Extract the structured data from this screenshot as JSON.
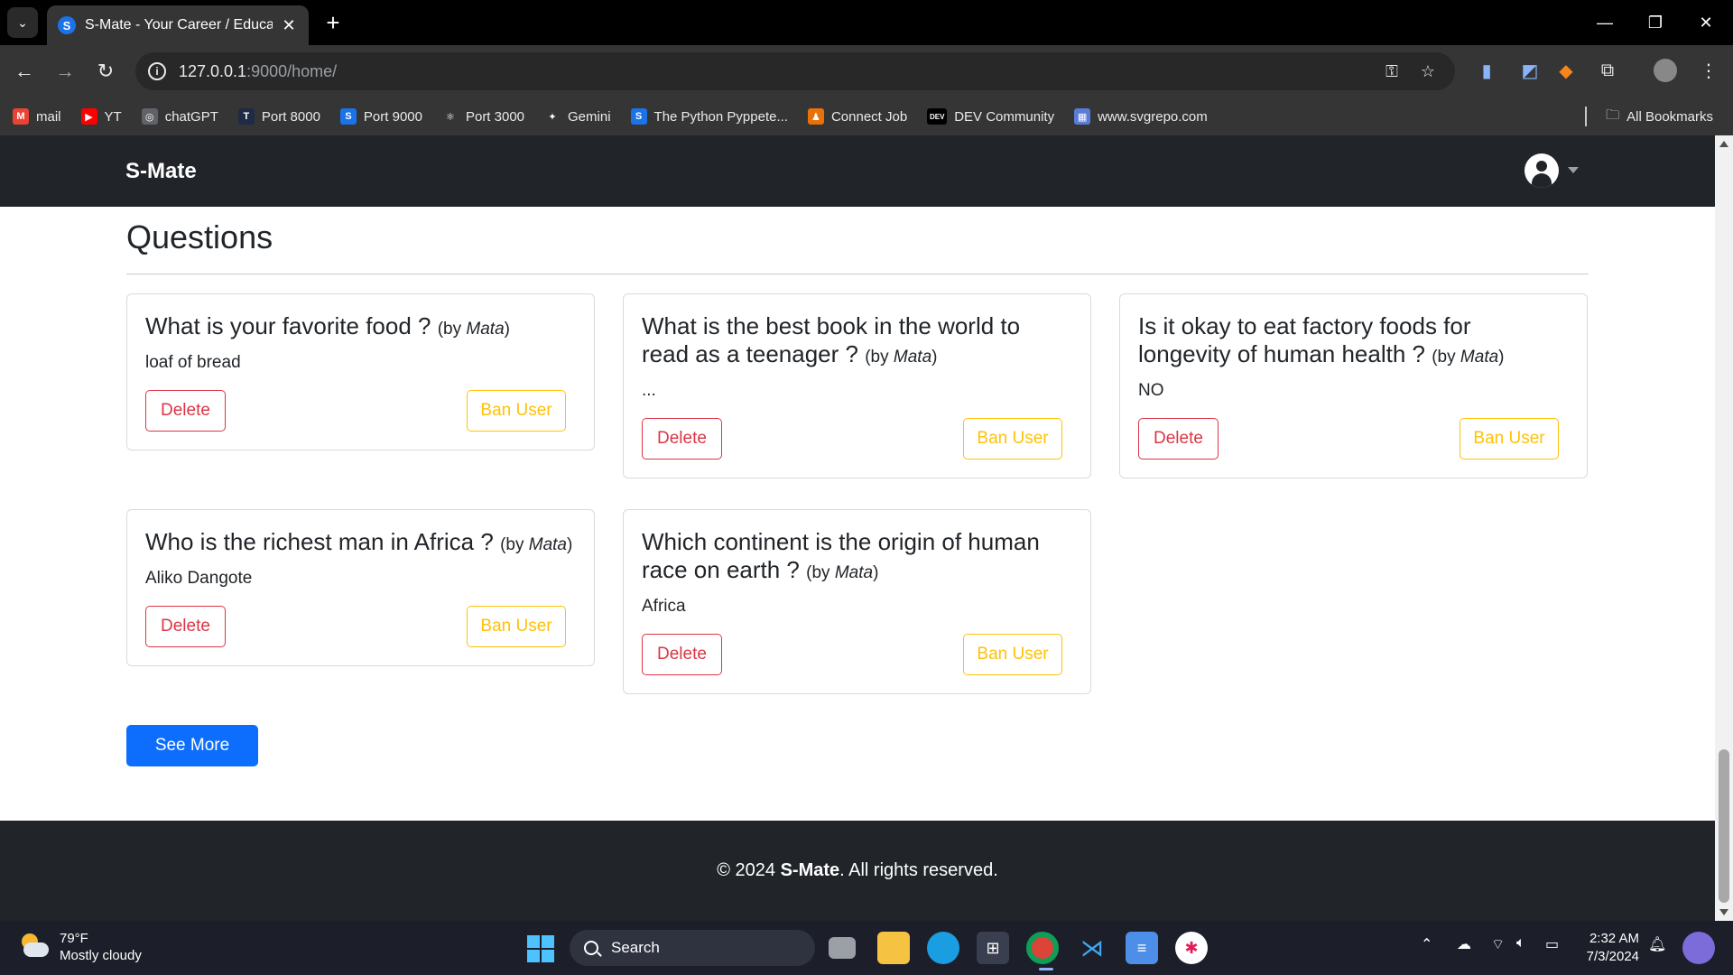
{
  "browser": {
    "tab_title": "S-Mate - Your Career / Educatio",
    "tab_favicon_letter": "S",
    "url_host": "127.0.0.1",
    "url_rest": ":9000/home/",
    "bookmarks": [
      {
        "label": "mail",
        "icon": "gmail-icon",
        "color": "#ea4335",
        "glyph": "M"
      },
      {
        "label": "YT",
        "icon": "youtube-icon",
        "color": "#ff0000",
        "glyph": "▶"
      },
      {
        "label": "chatGPT",
        "icon": "chatgpt-icon",
        "color": "#5f6368",
        "glyph": "◎"
      },
      {
        "label": "Port 8000",
        "icon": "port-8000-icon",
        "color": "#1f2a44",
        "glyph": "T"
      },
      {
        "label": "Port 9000",
        "icon": "port-9000-icon",
        "color": "#1a73e8",
        "glyph": "S"
      },
      {
        "label": "Port 3000",
        "icon": "react-icon",
        "color": "#353535",
        "glyph": "⚛"
      },
      {
        "label": "Gemini",
        "icon": "gemini-icon",
        "color": "#353535",
        "glyph": "✦"
      },
      {
        "label": "The Python Pyppete...",
        "icon": "python-pyppeteer-icon",
        "color": "#1a73e8",
        "glyph": "S"
      },
      {
        "label": "Connect Job",
        "icon": "connect-job-icon",
        "color": "#e8710a",
        "glyph": "♟"
      },
      {
        "label": "DEV Community",
        "icon": "dev-icon",
        "color": "#000000",
        "glyph": "DEV"
      },
      {
        "label": "www.svgrepo.com",
        "icon": "svgrepo-icon",
        "color": "#5a7bd8",
        "glyph": "▦"
      }
    ],
    "all_bookmarks": "All Bookmarks"
  },
  "app": {
    "brand": "S-Mate",
    "page_title": "Questions",
    "by_prefix": "(by ",
    "by_suffix": ")",
    "delete_label": "Delete",
    "ban_label": "Ban User",
    "see_more": "See More",
    "questions": [
      {
        "question": "What is your favorite food ?",
        "author": "Mata",
        "answer": "loaf of bread"
      },
      {
        "question": "What is the best book in the world to read as a teenager ?",
        "author": "Mata",
        "answer": "..."
      },
      {
        "question": "Is it okay to eat factory foods for longevity of human health ?",
        "author": "Mata",
        "answer": "NO"
      },
      {
        "question": "Who is the richest man in Africa ?",
        "author": "Mata",
        "answer": "Aliko Dangote"
      },
      {
        "question": "Which continent is the origin of human race on earth ?",
        "author": "Mata",
        "answer": "Africa"
      }
    ],
    "footer_prefix": "© 2024 ",
    "footer_brand": "S-Mate",
    "footer_suffix": ". All rights reserved."
  },
  "taskbar": {
    "temp": "79°F",
    "weather": "Mostly cloudy",
    "search": "Search",
    "time": "2:32 AM",
    "date": "7/3/2024"
  },
  "colors": {
    "navbar": "#212529",
    "danger": "#dc3545",
    "warning": "#ffc107",
    "primary": "#0d6efd"
  }
}
